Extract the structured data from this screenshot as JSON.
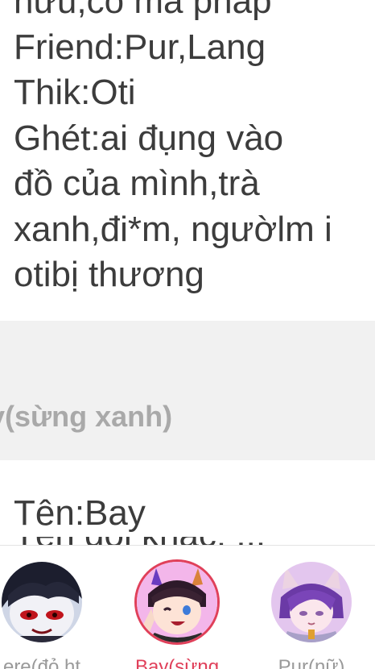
{
  "bio": {
    "lines": [
      "hưu,có ma pháp",
      "Friend:Pur,Lang",
      "Thik:Oti",
      "Ghét:ai đụng vào",
      "đồ của mình,trà",
      "xanh,đi*m, ngườlm i",
      "otibị thương"
    ]
  },
  "section": {
    "title": "ay(sừng xanh)"
  },
  "next_entry": {
    "name_line": "Tên:Bay",
    "partial_line": "Tên gọi khác: ..."
  },
  "characters": [
    {
      "label": "ere(đỏ ht",
      "selected": false,
      "avatar_icon": "dark-hair-red-eyes-avatar"
    },
    {
      "label": "Bay(sừng",
      "selected": true,
      "avatar_icon": "horned-winking-avatar"
    },
    {
      "label": "Pur(nữ)",
      "selected": false,
      "avatar_icon": "purple-hair-cat-ears-avatar"
    }
  ],
  "colors": {
    "accent": "#e0405a",
    "section_bg": "#f1f1f1",
    "body_text": "#3c3c3c",
    "muted_text": "#a9a9a9"
  }
}
